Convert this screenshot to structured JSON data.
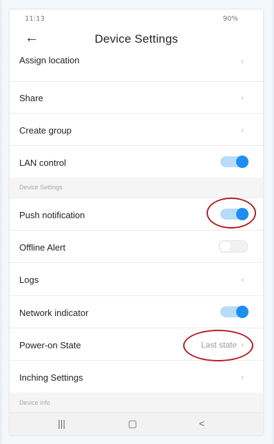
{
  "status_bar": {
    "time": "11:13",
    "signal": "90%"
  },
  "header": {
    "title": "Device Settings"
  },
  "rows": {
    "assign_location": "Assign location",
    "share": "Share",
    "create_group": "Create group",
    "lan_control": "LAN control",
    "section_device_settings": "Device Settings",
    "push_notification": "Push notification",
    "offline_alert": "Offline Alert",
    "logs": "Logs",
    "network_indicator": "Network indicator",
    "power_on_state": "Power-on State",
    "power_on_state_value": "Last state",
    "inching_settings": "Inching Settings",
    "section_device_info": "Device info"
  },
  "toggles": {
    "lan_control": true,
    "push_notification": true,
    "offline_alert": false,
    "network_indicator": true
  },
  "nav": {
    "recents": "|||",
    "home": "▢",
    "back": "<"
  },
  "colors": {
    "accent": "#1e8ff0",
    "annotation": "#b21c22"
  }
}
